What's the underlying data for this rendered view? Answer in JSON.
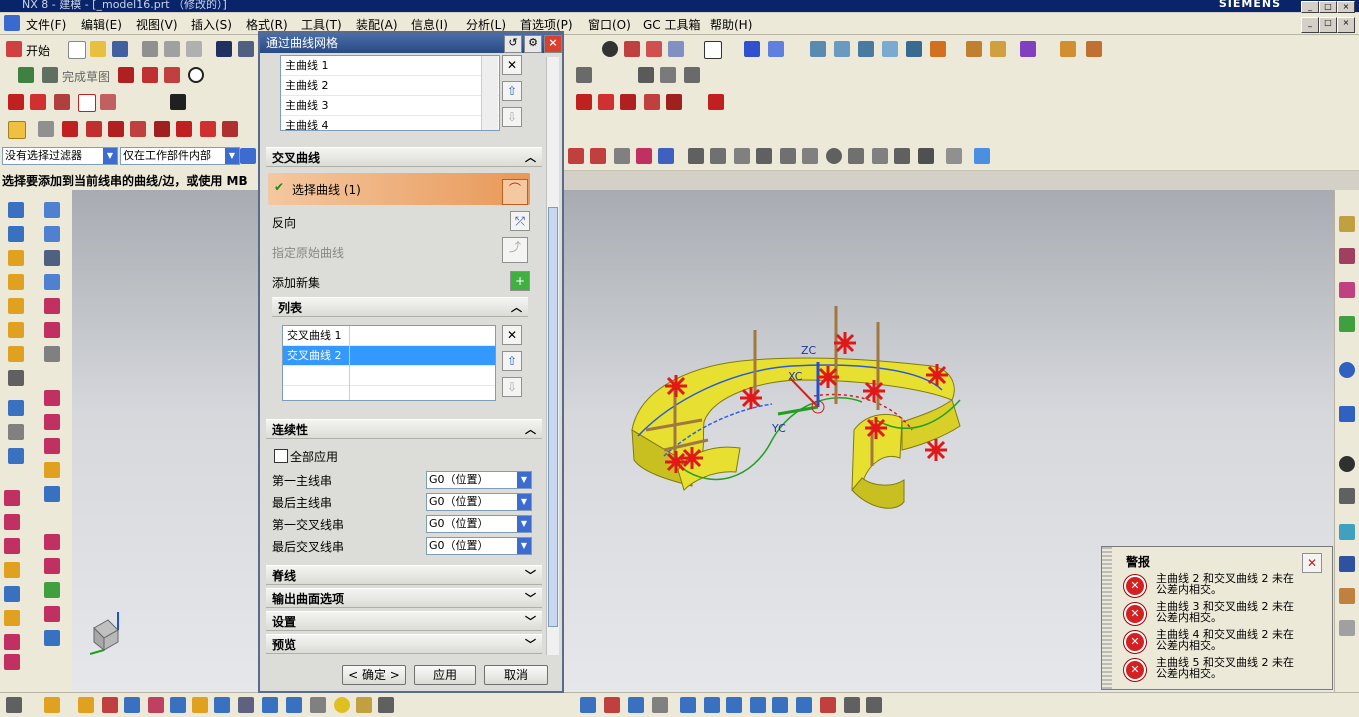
{
  "window": {
    "title": "NX 8 - 建模 - [_model16.prt （修改的）]",
    "brand": "SIEMENS"
  },
  "menu": [
    "文件(F)",
    "编辑(E)",
    "视图(V)",
    "插入(S)",
    "格式(R)",
    "工具(T)",
    "装配(A)",
    "信息(I)",
    "分析(L)",
    "首选项(P)",
    "窗口(O)",
    "GC 工具箱",
    "帮助(H)"
  ],
  "toolbar": {
    "start_label": "开始",
    "finish_sketch_label": "完成草图"
  },
  "filters": {
    "selection_filter": "没有选择过滤器",
    "scope": "仅在工作部件内部"
  },
  "status": {
    "prompt": "选择要添加到当前线串的曲线/边，或使用 MB"
  },
  "dialog": {
    "title": "通过曲线网格",
    "primary_list": [
      "主曲线 1",
      "主曲线 2",
      "主曲线 3",
      "主曲线 4"
    ],
    "cross_section": {
      "header": "交叉曲线",
      "select_curve": "选择曲线 (1)",
      "reverse": "反向",
      "specify_origin": "指定原始曲线",
      "add_new_set": "添加新集",
      "list_header": "列表",
      "list": [
        "交叉曲线 1",
        "交叉曲线 2"
      ]
    },
    "continuity": {
      "header": "连续性",
      "apply_all": "全部应用",
      "rows": [
        {
          "label": "第一主线串",
          "value": "G0（位置）"
        },
        {
          "label": "最后主线串",
          "value": "G0（位置）"
        },
        {
          "label": "第一交叉线串",
          "value": "G0（位置）"
        },
        {
          "label": "最后交叉线串",
          "value": "G0（位置）"
        }
      ]
    },
    "collapsed_sections": [
      "脊线",
      "输出曲面选项",
      "设置",
      "预览"
    ],
    "buttons": {
      "ok": "< 确定 >",
      "apply": "应用",
      "cancel": "取消"
    }
  },
  "viewport": {
    "axis_labels": {
      "zc": "ZC",
      "xc": "XC",
      "yc": "YC"
    }
  },
  "alert": {
    "title": "警报",
    "items": [
      "主曲线 2 和交叉曲线 2 未在公差内相交。",
      "主曲线 3 和交叉曲线 2 未在公差内相交。",
      "主曲线 4 和交叉曲线 2 未在公差内相交。",
      "主曲线 5 和交叉曲线 2 未在公差内相交。"
    ]
  },
  "colors": {
    "surface": "#e8e030",
    "marker": "#e01818",
    "selection": "#3399ff",
    "accent": "#e89858"
  }
}
